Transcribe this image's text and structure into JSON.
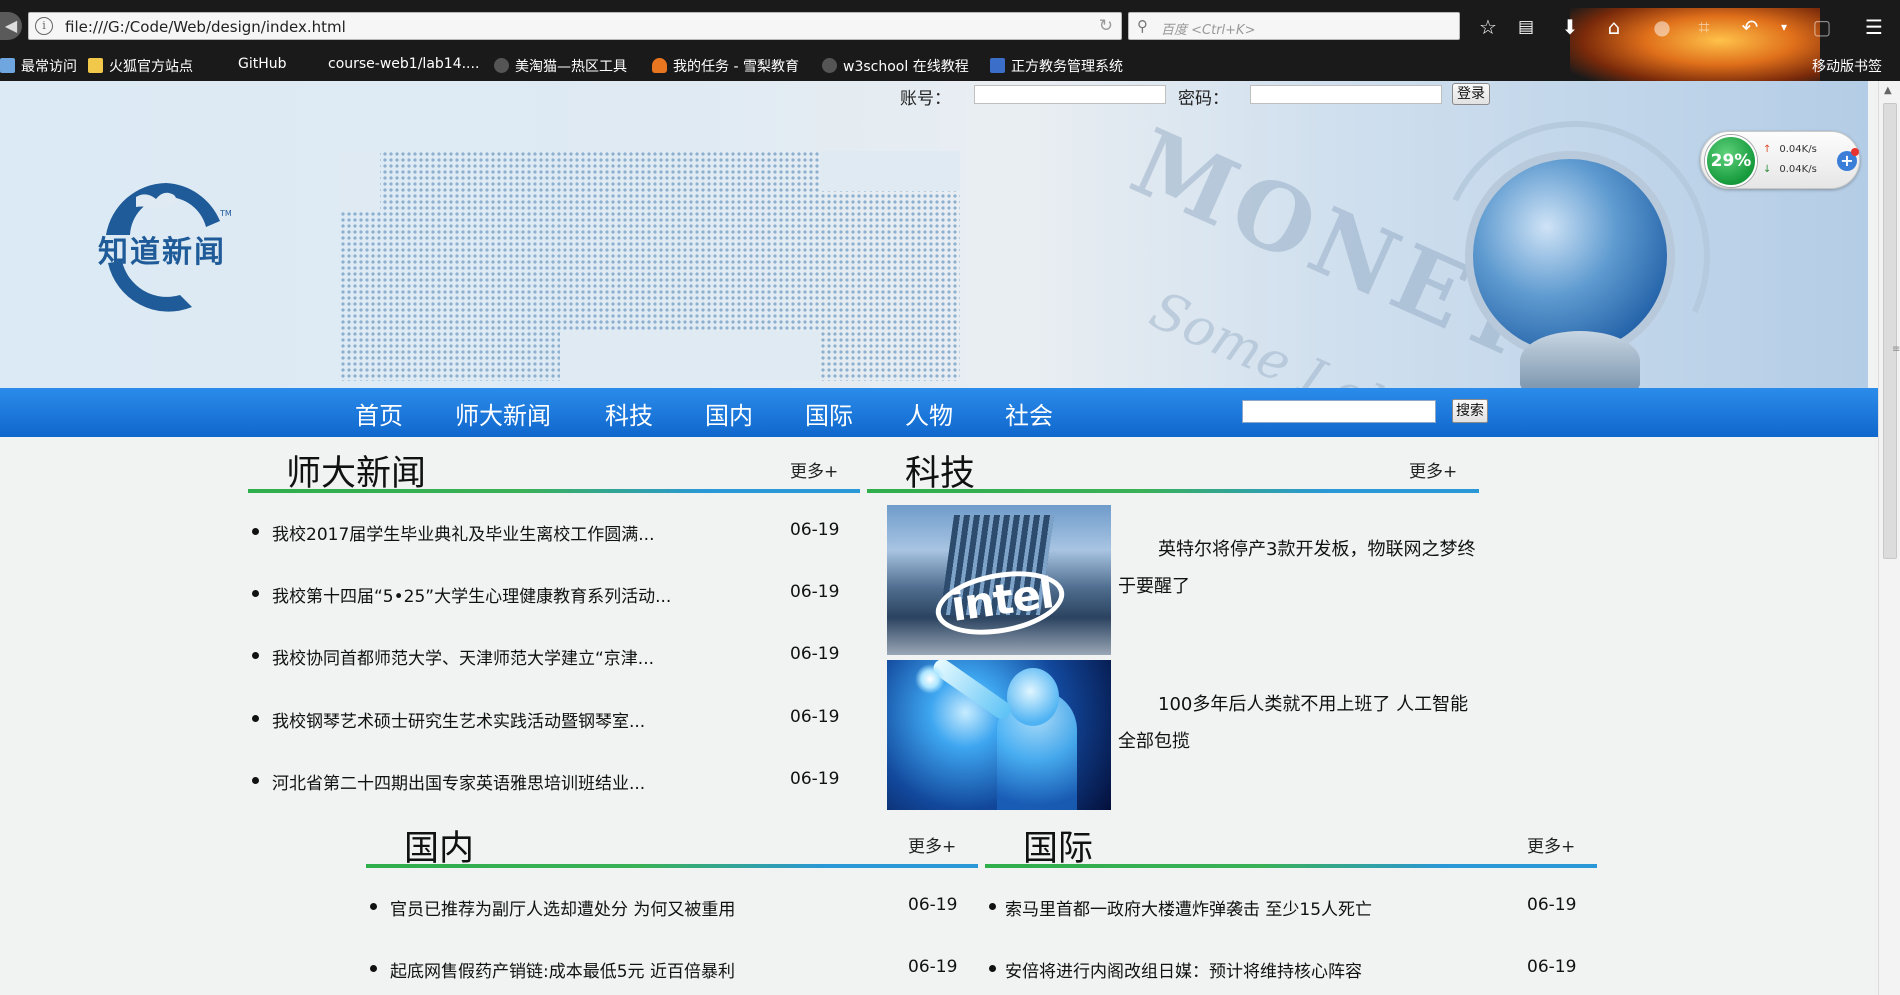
{
  "browser": {
    "url": "file:///G:/Code/Web/design/index.html",
    "search_placeholder": "百度 <Ctrl+K>",
    "bookmarks": [
      {
        "label": "最常访问"
      },
      {
        "label": "火狐官方站点"
      },
      {
        "label": "GitHub"
      },
      {
        "label": "course-web1/lab14...."
      },
      {
        "label": "美淘猫—热区工具"
      },
      {
        "label": "我的任务 - 雪梨教育"
      },
      {
        "label": "w3school 在线教程"
      },
      {
        "label": "正方教务管理系统"
      }
    ],
    "mobile_bookmarks": "移动版书签"
  },
  "speed_widget": {
    "percent": "29%",
    "upload": "0.04K/s",
    "download": "0.04K/s"
  },
  "header": {
    "logo_text": "知道新闻",
    "logo_tm": "TM",
    "banner_text_1": "MONEY",
    "banner_text_2": "Some Lehm",
    "login": {
      "account_label": "账号：",
      "password_label": "密码：",
      "login_button": "登录"
    }
  },
  "nav": {
    "items": [
      "首页",
      "师大新闻",
      "科技",
      "国内",
      "国际",
      "人物",
      "社会"
    ],
    "search_button": "搜索"
  },
  "sections": {
    "shida": {
      "title": "师大新闻",
      "more": "更多+",
      "items": [
        {
          "title": "我校2017届学生毕业典礼及毕业生离校工作圆满...",
          "date": "06-19"
        },
        {
          "title": "我校第十四届“5•25”大学生心理健康教育系列活动...",
          "date": "06-19"
        },
        {
          "title": "我校协同首都师范大学、天津师范大学建立“京津...",
          "date": "06-19"
        },
        {
          "title": "我校钢琴艺术硕士研究生艺术实践活动暨钢琴室...",
          "date": "06-19"
        },
        {
          "title": "河北省第二十四期出国专家英语雅思培训班结业...",
          "date": "06-19"
        }
      ]
    },
    "tech": {
      "title": "科技",
      "more": "更多+",
      "items": [
        {
          "text": "英特尔将停产3款开发板，物联网之梦终于要醒了",
          "image_word": "intel"
        },
        {
          "text": "100多年后人类就不用上班了 人工智能全部包揽"
        }
      ]
    },
    "domestic": {
      "title": "国内",
      "more": "更多+",
      "items": [
        {
          "title": "官员已推荐为副厅人选却遭处分 为何又被重用",
          "date": "06-19"
        },
        {
          "title": "起底网售假药产销链:成本最低5元 近百倍暴利",
          "date": "06-19"
        }
      ]
    },
    "international": {
      "title": "国际",
      "more": "更多+",
      "items": [
        {
          "title": "索马里首都一政府大楼遭炸弹袭击 至少15人死亡",
          "date": "06-19"
        },
        {
          "title": "安倍将进行内阁改组日媒：预计将维持核心阵容",
          "date": "06-19"
        }
      ]
    }
  }
}
